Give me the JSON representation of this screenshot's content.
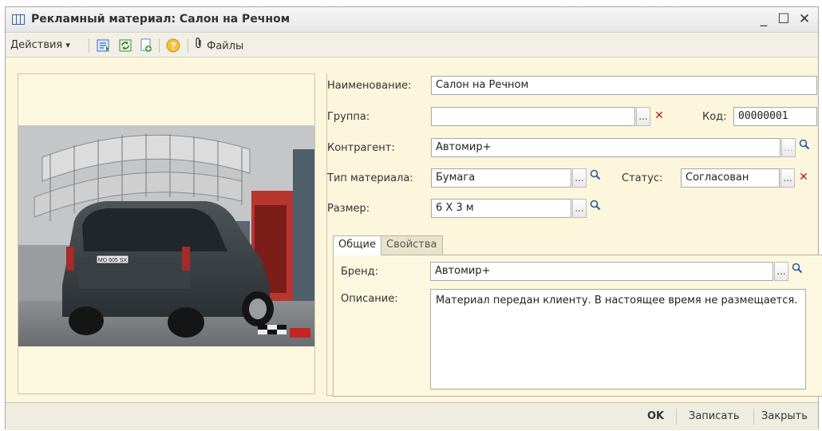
{
  "window": {
    "title": "Рекламный материал: Салон на Речном",
    "minimize": "_",
    "maximize": "☐",
    "close": "✕"
  },
  "toolbar": {
    "actions_label": "Действия",
    "actions_arrow": "▾",
    "files_label": "Файлы",
    "help_glyph": "?",
    "icons": [
      "move-down-icon",
      "refresh-icon",
      "copy-new-icon",
      "help-icon",
      "paperclip-icon"
    ]
  },
  "photo": {
    "plate_text": "MO 605 SX"
  },
  "form": {
    "name_label": "Наименование:",
    "name_value": "Салон на Речном",
    "group_label": "Группа:",
    "group_value": "",
    "code_label": "Код:",
    "code_value": "00000001",
    "counterparty_label": "Контрагент:",
    "counterparty_value": "Автомир+",
    "type_label": "Тип материала:",
    "type_value": "Бумага",
    "status_label": "Статус:",
    "status_value": "Согласован",
    "size_label": "Размер:",
    "size_value": "6 Х 3 м",
    "dots": "...",
    "clear_glyph": "✕",
    "search_glyph": "🔍"
  },
  "tabs": [
    {
      "label": "Общие",
      "active": true
    },
    {
      "label": "Свойства",
      "active": false
    }
  ],
  "general_tab": {
    "brand_label": "Бренд:",
    "brand_value": "Автомир+",
    "description_label": "Описание:",
    "description_value": "Материал передан клиенту. В настоящее время не размещается."
  },
  "footer": {
    "ok_label": "OK",
    "save_label": "Записать",
    "close_label": "Закрыть"
  },
  "colors": {
    "form_background": "#fbf6dc",
    "titlebar": "#ececec",
    "accent_blue": "#2c63b5",
    "clear_red": "#b02020"
  }
}
